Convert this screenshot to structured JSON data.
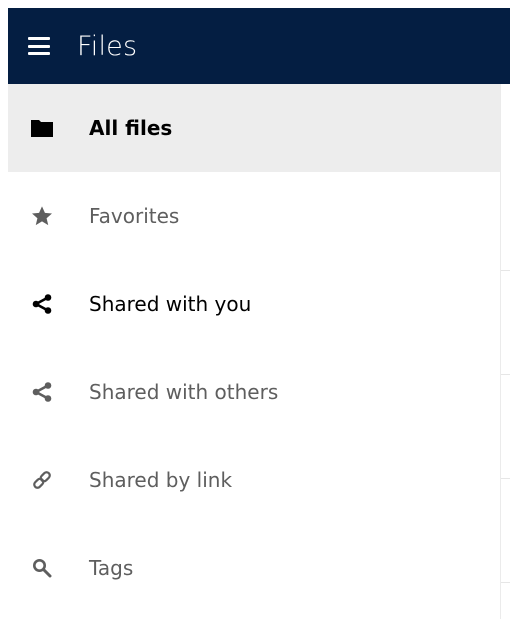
{
  "app": {
    "title": "Files"
  },
  "colors": {
    "header_bg": "#041e42",
    "active_bg": "#ededed",
    "muted_text": "#5e5e5e",
    "strong_text": "#000000"
  },
  "sidebar": {
    "items": [
      {
        "label": "All files",
        "icon": "folder-icon",
        "active": true
      },
      {
        "label": "Favorites",
        "icon": "star-icon",
        "active": false
      },
      {
        "label": "Shared with you",
        "icon": "share-icon",
        "active": false
      },
      {
        "label": "Shared with others",
        "icon": "share-icon",
        "active": false
      },
      {
        "label": "Shared by link",
        "icon": "link-icon",
        "active": false
      },
      {
        "label": "Tags",
        "icon": "search-icon",
        "active": false
      }
    ]
  }
}
